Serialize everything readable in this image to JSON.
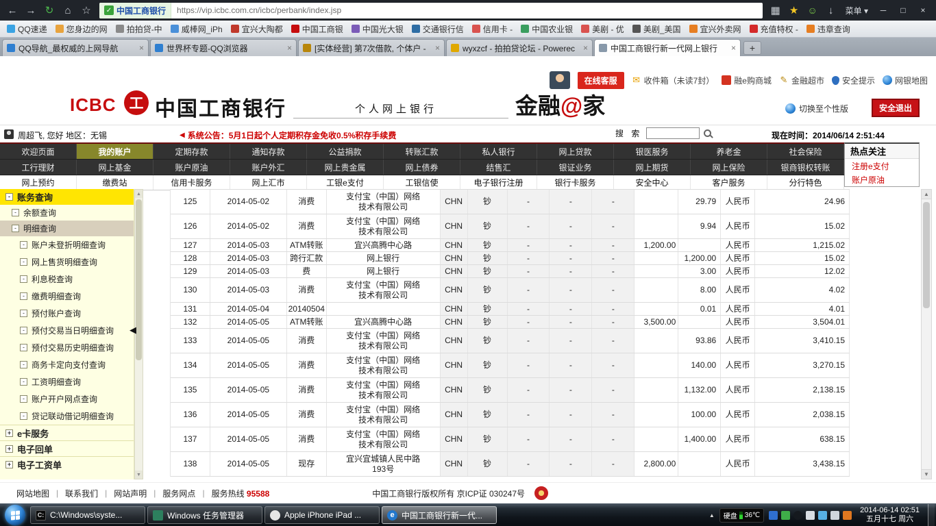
{
  "browser": {
    "menu_label": "菜单",
    "address": {
      "badge": "中国工商银行",
      "url": "https://vip.icbc.com.cn/icbc/perbank/index.jsp"
    },
    "bookmarks": [
      {
        "label": "QQ速递",
        "color": "#3aa3e3"
      },
      {
        "label": "您身边的网",
        "color": "#e8a33d"
      },
      {
        "label": "拍拍贷-中",
        "color": "#8a8a8a"
      },
      {
        "label": "威棒网_iPh",
        "color": "#4a90d9"
      },
      {
        "label": "宜兴大陶都",
        "color": "#c0392b"
      },
      {
        "label": "中国工商银",
        "color": "#c60d0e"
      },
      {
        "label": "中国光大银",
        "color": "#7b5cb8"
      },
      {
        "label": "交通银行信",
        "color": "#2e6da4"
      },
      {
        "label": "信用卡 -",
        "color": "#d9534f"
      },
      {
        "label": "中国农业银",
        "color": "#3a9e5f"
      },
      {
        "label": "美剧 - 优",
        "color": "#d9534f"
      },
      {
        "label": "美剧_美国",
        "color": "#555555"
      },
      {
        "label": "宜兴外卖网",
        "color": "#e67e22"
      },
      {
        "label": "充值特权 -",
        "color": "#d42a2a"
      },
      {
        "label": "违章查询",
        "color": "#e67e22"
      }
    ],
    "tabs": [
      {
        "title": "QQ导航_最权威的上网导航",
        "color": "#2f7fd0",
        "active": false
      },
      {
        "title": "世界杯专题-QQ浏览器",
        "color": "#2f7fd0",
        "active": false
      },
      {
        "title": "[实体经营] 第7次借款, 个体户 -",
        "color": "#b8860b",
        "active": false
      },
      {
        "title": "wyxzcf - 拍拍贷论坛 - Powerec",
        "color": "#e0a800",
        "active": false
      },
      {
        "title": "中国工商银行新一代网上银行",
        "color": "#8899aa",
        "active": true
      }
    ]
  },
  "bank": {
    "logo_text": "ICBC",
    "seal_glyph": "工",
    "bank_name": "中国工商银行",
    "subtitle": "个人网上银行",
    "brand": {
      "left": "金融",
      "at": "@",
      "right": "家"
    },
    "service_button": "在线客服",
    "quick_links": [
      {
        "label": "收件箱（未读7封）",
        "icon": "mail"
      },
      {
        "label": "融e购商城",
        "icon": "cart"
      },
      {
        "label": "金融超市",
        "icon": "pen"
      },
      {
        "label": "安全提示",
        "icon": "shield"
      },
      {
        "label": "网银地图",
        "icon": "globe"
      }
    ],
    "switch_version": "切换至个性版",
    "logout_button": "安全退出",
    "user_greeting": "周超飞, 您好  地区：无锡",
    "announcement": "系统公告：5月1日起个人定期积存金免收0.5%积存手续费",
    "search_label": "搜 索",
    "time_text": "现在时间：2014/06/14 2:51:44",
    "nav_rows": [
      {
        "items": [
          "欢迎页面",
          "我的账户",
          "定期存款",
          "通知存款",
          "公益捐款",
          "转账汇款",
          "私人银行",
          "网上贷款",
          "银医服务",
          "养老金",
          "社会保险"
        ],
        "active_index": 1
      },
      {
        "items": [
          "工行理财",
          "网上基金",
          "账户原油",
          "账户外汇",
          "网上贵金属",
          "网上债券",
          "结售汇",
          "银证业务",
          "网上期货",
          "网上保险",
          "银商银权转账"
        ],
        "active_index": -1
      },
      {
        "items": [
          "网上预约",
          "缴费站",
          "信用卡服务",
          "网上汇市",
          "工银e支付",
          "工银信使",
          "电子银行注册",
          "银行卡服务",
          "安全中心",
          "客户服务",
          "分行特色"
        ],
        "active_index": -1
      }
    ],
    "hot_panel": {
      "title": "热点关注",
      "links": [
        "注册e支付",
        "账户原油"
      ]
    }
  },
  "sidebar": {
    "tree": [
      {
        "label": "账务查询",
        "type": "root-open"
      },
      {
        "label": "余额查询",
        "type": "item"
      },
      {
        "label": "明细查询",
        "type": "item",
        "selected": true
      },
      {
        "label": "账户未登折明细查询",
        "type": "sub"
      },
      {
        "label": "网上售货明细查询",
        "type": "sub"
      },
      {
        "label": "利息税查询",
        "type": "sub"
      },
      {
        "label": "缴费明细查询",
        "type": "sub"
      },
      {
        "label": "预付账户查询",
        "type": "sub"
      },
      {
        "label": "预付交易当日明细查询",
        "type": "sub"
      },
      {
        "label": "预付交易历史明细查询",
        "type": "sub"
      },
      {
        "label": "商务卡定向支付查询",
        "type": "sub"
      },
      {
        "label": "工资明细查询",
        "type": "sub"
      },
      {
        "label": "账户开户网点查询",
        "type": "sub"
      },
      {
        "label": "贷记联动借记明细查询",
        "type": "sub"
      },
      {
        "label": "e卡服务",
        "type": "root-closed"
      },
      {
        "label": "电子回单",
        "type": "root-closed"
      },
      {
        "label": "电子工资单",
        "type": "root-closed"
      }
    ]
  },
  "table": {
    "rows": [
      {
        "no": "125",
        "date": "2014-05-02",
        "summary": "消费",
        "party": "支付宝（中国）网络技术有限公司",
        "region": "CHN",
        "cash": "钞",
        "c1": "-",
        "c2": "-",
        "c3": "-",
        "income": "",
        "expense": "29.79",
        "currency": "人民币",
        "balance": "24.96"
      },
      {
        "no": "126",
        "date": "2014-05-02",
        "summary": "消费",
        "party": "支付宝（中国）网络技术有限公司",
        "region": "CHN",
        "cash": "钞",
        "c1": "-",
        "c2": "-",
        "c3": "-",
        "income": "",
        "expense": "9.94",
        "currency": "人民币",
        "balance": "15.02"
      },
      {
        "no": "127",
        "date": "2014-05-03",
        "summary": "ATM转账",
        "party": "宜兴高腾中心路",
        "region": "CHN",
        "cash": "钞",
        "c1": "-",
        "c2": "-",
        "c3": "-",
        "income": "1,200.00",
        "expense": "",
        "currency": "人民币",
        "balance": "1,215.02"
      },
      {
        "no": "128",
        "date": "2014-05-03",
        "summary": "跨行汇款",
        "party": "网上银行",
        "region": "CHN",
        "cash": "钞",
        "c1": "-",
        "c2": "-",
        "c3": "-",
        "income": "",
        "expense": "1,200.00",
        "currency": "人民币",
        "balance": "15.02"
      },
      {
        "no": "129",
        "date": "2014-05-03",
        "summary": "费",
        "party": "网上银行",
        "region": "CHN",
        "cash": "钞",
        "c1": "-",
        "c2": "-",
        "c3": "-",
        "income": "",
        "expense": "3.00",
        "currency": "人民币",
        "balance": "12.02"
      },
      {
        "no": "130",
        "date": "2014-05-03",
        "summary": "消费",
        "party": "支付宝（中国）网络技术有限公司",
        "region": "CHN",
        "cash": "钞",
        "c1": "-",
        "c2": "-",
        "c3": "-",
        "income": "",
        "expense": "8.00",
        "currency": "人民币",
        "balance": "4.02"
      },
      {
        "no": "131",
        "date": "2014-05-04",
        "summary": "20140504",
        "party": "",
        "region": "CHN",
        "cash": "钞",
        "c1": "-",
        "c2": "-",
        "c3": "-",
        "income": "",
        "expense": "0.01",
        "currency": "人民币",
        "balance": "4.01"
      },
      {
        "no": "132",
        "date": "2014-05-05",
        "summary": "ATM转账",
        "party": "宜兴高腾中心路",
        "region": "CHN",
        "cash": "钞",
        "c1": "-",
        "c2": "-",
        "c3": "-",
        "income": "3,500.00",
        "expense": "",
        "currency": "人民币",
        "balance": "3,504.01"
      },
      {
        "no": "133",
        "date": "2014-05-05",
        "summary": "消费",
        "party": "支付宝（中国）网络技术有限公司",
        "region": "CHN",
        "cash": "钞",
        "c1": "-",
        "c2": "-",
        "c3": "-",
        "income": "",
        "expense": "93.86",
        "currency": "人民币",
        "balance": "3,410.15"
      },
      {
        "no": "134",
        "date": "2014-05-05",
        "summary": "消费",
        "party": "支付宝（中国）网络技术有限公司",
        "region": "CHN",
        "cash": "钞",
        "c1": "-",
        "c2": "-",
        "c3": "-",
        "income": "",
        "expense": "140.00",
        "currency": "人民币",
        "balance": "3,270.15"
      },
      {
        "no": "135",
        "date": "2014-05-05",
        "summary": "消费",
        "party": "支付宝（中国）网络技术有限公司",
        "region": "CHN",
        "cash": "钞",
        "c1": "-",
        "c2": "-",
        "c3": "-",
        "income": "",
        "expense": "1,132.00",
        "currency": "人民币",
        "balance": "2,138.15"
      },
      {
        "no": "136",
        "date": "2014-05-05",
        "summary": "消费",
        "party": "支付宝（中国）网络技术有限公司",
        "region": "CHN",
        "cash": "钞",
        "c1": "-",
        "c2": "-",
        "c3": "-",
        "income": "",
        "expense": "100.00",
        "currency": "人民币",
        "balance": "2,038.15"
      },
      {
        "no": "137",
        "date": "2014-05-05",
        "summary": "消费",
        "party": "支付宝（中国）网络技术有限公司",
        "region": "CHN",
        "cash": "钞",
        "c1": "-",
        "c2": "-",
        "c3": "-",
        "income": "",
        "expense": "1,400.00",
        "currency": "人民币",
        "balance": "638.15"
      },
      {
        "no": "138",
        "date": "2014-05-05",
        "summary": "现存",
        "party": "宜兴宜城镇人民中路193号",
        "region": "CHN",
        "cash": "钞",
        "c1": "-",
        "c2": "-",
        "c3": "-",
        "income": "2,800.00",
        "expense": "",
        "currency": "人民币",
        "balance": "3,438.15"
      }
    ]
  },
  "footer": {
    "links": [
      "网站地图",
      "联系我们",
      "网站声明",
      "服务网点"
    ],
    "hotline_label": "服务热线",
    "hotline_number": "95588",
    "copyright": "中国工商银行版权所有  京ICP证 030247号"
  },
  "taskbar": {
    "buttons": [
      {
        "label": "C:\\Windows\\syste...",
        "icon": "cmd",
        "active": false
      },
      {
        "label": "Windows 任务管理器",
        "icon": "task",
        "active": false
      },
      {
        "label": "Apple iPhone iPad ...",
        "icon": "apple",
        "active": false
      },
      {
        "label": "中国工商银行新一代...",
        "icon": "ie",
        "active": true
      }
    ],
    "tray": {
      "disk_label": "硬盘",
      "disk_temp": "36℃",
      "clock_line1": "2014-06-14  02:51",
      "clock_line2": "五月十七 周六",
      "icons": [
        {
          "name": "ime-icon",
          "color": "#2f6fd0"
        },
        {
          "name": "security-icon",
          "color": "#3fae49"
        },
        {
          "name": "qq-icon",
          "color": "#15191e"
        },
        {
          "name": "phone-assistant-icon",
          "color": "#d8dde2"
        },
        {
          "name": "download-manager-icon",
          "color": "#57b0e3"
        },
        {
          "name": "network-icon",
          "color": "#cfd6dd"
        },
        {
          "name": "volume-icon",
          "color": "#e07820"
        }
      ]
    }
  }
}
